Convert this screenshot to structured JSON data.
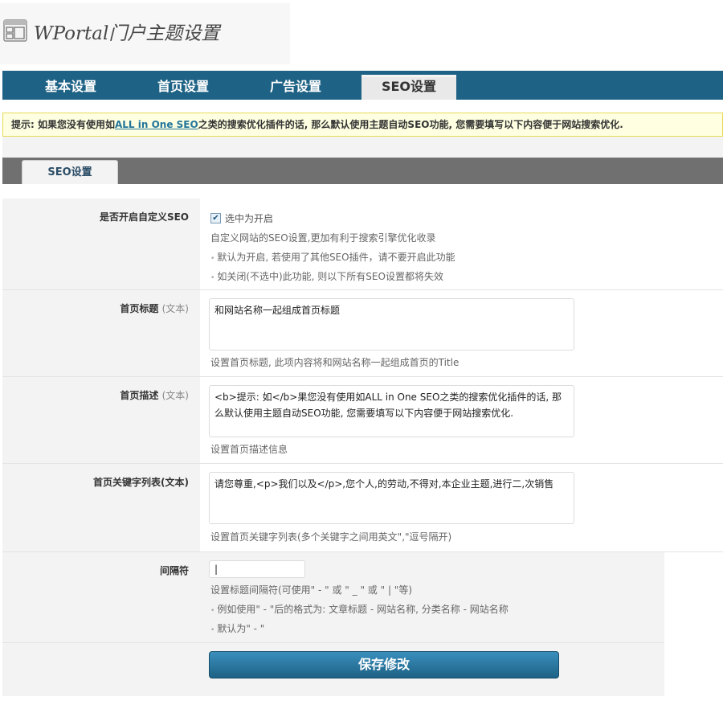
{
  "header": {
    "title": "WPortal门户主题设置",
    "icon": "layout-icon"
  },
  "nav": {
    "tabs": [
      {
        "label": "基本设置",
        "active": false
      },
      {
        "label": "首页设置",
        "active": false
      },
      {
        "label": "广告设置",
        "active": false
      },
      {
        "label": "SEO设置",
        "active": true
      }
    ]
  },
  "notice": {
    "prefix": "提示: 如果您没有使用如",
    "link": "ALL in One SEO",
    "suffix": "之类的搜索优化插件的话, 那么默认使用主题自动SEO功能, 您需要填写以下内容便于网站搜索优化."
  },
  "subtab": {
    "label": "SEO设置"
  },
  "form": {
    "enable_seo": {
      "label": "是否开启自定义SEO",
      "checkbox_label": "选中为开启",
      "checked": true,
      "desc1": "自定义网站的SEO设置,更加有利于搜索引擎优化收录",
      "desc2": "默认为开启, 若使用了其他SEO插件，请不要开启此功能",
      "desc3": "如关闭(不选中)此功能, 则以下所有SEO设置都将失效"
    },
    "home_title": {
      "label": "首页标题",
      "hint": "(文本)",
      "value": "和网站名称一起组成首页标题",
      "desc": "设置首页标题, 此项内容将和网站名称一起组成首页的Title"
    },
    "home_desc": {
      "label": "首页描述",
      "hint": "(文本)",
      "value": "<b>提示: 如</b>果您没有使用如ALL in One SEO之类的搜索优化插件的话, 那么默认使用主题自动SEO功能, 您需要填写以下内容便于网站搜索优化.",
      "desc": "设置首页描述信息"
    },
    "home_keywords": {
      "label": "首页关键字列表(文本)",
      "value": "请您尊重,<p>我们以及</p>,您个人,的劳动,不得对,本企业主题,进行二,次销售",
      "desc": "设置首页关键字列表(多个关键字之间用英文\",\"逗号隔开)"
    },
    "separator": {
      "label": "间隔符",
      "value": "|",
      "desc1": "设置标题间隔符(可使用\" - \" 或 \" _ \" 或 \" | \"等)",
      "desc2": "例如使用\" - \"后的格式为: 文章标题 - 网站名称, 分类名称 - 网站名称",
      "desc3": "默认为\" - \""
    },
    "save_label": "保存修改"
  }
}
